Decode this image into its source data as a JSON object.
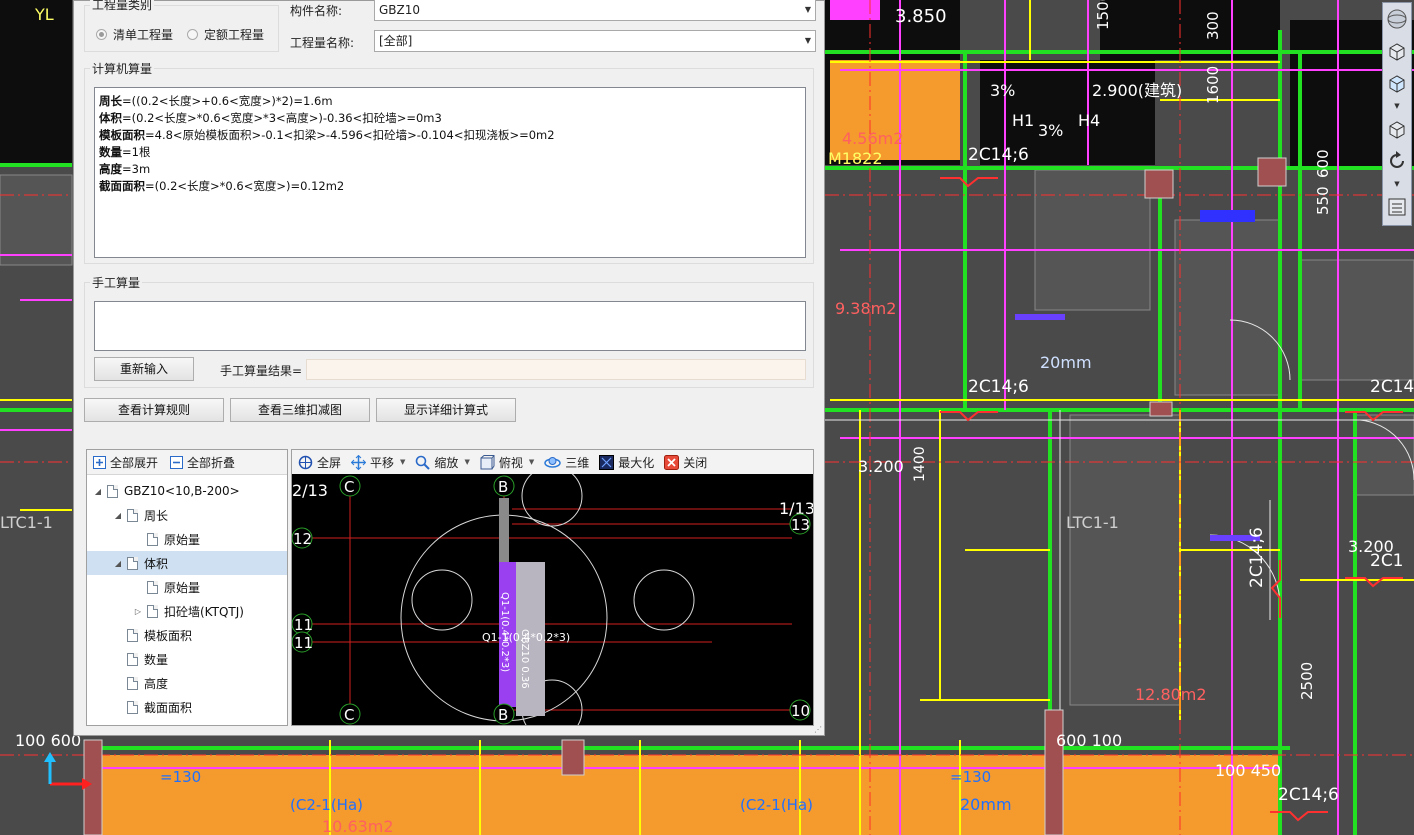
{
  "dialog": {
    "quantity_type": {
      "group_title": "工程量类别",
      "options": [
        {
          "label": "清单工程量",
          "selected": true
        },
        {
          "label": "定额工程量",
          "selected": false
        }
      ]
    },
    "component_name_label": "构件名称:",
    "component_name_value": "GBZ10",
    "quantity_name_label": "工程量名称:",
    "quantity_name_value": "[全部]",
    "computer_calc": {
      "title": "计算机算量",
      "lines": [
        {
          "key": "周长",
          "expr": "=((0.2<长度>+0.6<宽度>)*2)=1.6m"
        },
        {
          "key": "体积",
          "expr": "=(0.2<长度>*0.6<宽度>*3<高度>)-0.36<扣砼墙>=0m3"
        },
        {
          "key": "模板面积",
          "expr": "=4.8<原始模板面积>-0.1<扣梁>-4.596<扣砼墙>-0.104<扣现浇板>=0m2"
        },
        {
          "key": "数量",
          "expr": "=1根"
        },
        {
          "key": "高度",
          "expr": "=3m"
        },
        {
          "key": "截面面积",
          "expr": "=(0.2<长度>*0.6<宽度>)=0.12m2"
        }
      ]
    },
    "manual_calc": {
      "title": "手工算量",
      "reenter_button": "重新输入",
      "result_label": "手工算量结果="
    },
    "buttons": {
      "view_rules": "查看计算规则",
      "view_3d": "查看三维扣减图",
      "show_detail": "显示详细计算式"
    },
    "tree_toolbar": {
      "expand_all": "全部展开",
      "collapse_all": "全部折叠"
    },
    "tree": [
      {
        "label": "GBZ10<10,B-200>",
        "level": 0,
        "toggle": "expanded",
        "selected": false
      },
      {
        "label": "周长",
        "level": 1,
        "toggle": "expanded",
        "selected": false
      },
      {
        "label": "原始量",
        "level": 2,
        "toggle": "none",
        "selected": false
      },
      {
        "label": "体积",
        "level": 1,
        "toggle": "expanded",
        "selected": true
      },
      {
        "label": "原始量",
        "level": 2,
        "toggle": "none",
        "selected": false
      },
      {
        "label": "扣砼墙(KTQTJ)",
        "level": 2,
        "toggle": "collapsed",
        "selected": false
      },
      {
        "label": "模板面积",
        "level": 1,
        "toggle": "none",
        "selected": false
      },
      {
        "label": "数量",
        "level": 1,
        "toggle": "none",
        "selected": false
      },
      {
        "label": "高度",
        "level": 1,
        "toggle": "none",
        "selected": false
      },
      {
        "label": "截面面积",
        "level": 1,
        "toggle": "none",
        "selected": false
      }
    ],
    "viewer_toolbar": {
      "fullscreen": "全屏",
      "pan": "平移",
      "zoom": "缩放",
      "top_view": "俯视",
      "three_d": "三维",
      "maximize": "最大化",
      "close": "关闭"
    },
    "viewer_labels": {
      "axis_left_top": "2/13",
      "axis_c_top": "C",
      "axis_b_top": "B",
      "axis_right_top_a": "1/13",
      "axis_right_top_b": "13",
      "axis_12": "12",
      "axis_11a": "11",
      "axis_11b": "11",
      "axis_c_bottom": "C",
      "axis_b_bottom": "B",
      "axis_10": "10",
      "wall_label": "Q1-1(0.4*0.2*3)",
      "wall_vertical_label": "Q1-1(0.4*0.2*3)",
      "column_label": "GBZ10 0.36"
    }
  },
  "cad_labels": {
    "elev_1": "3.850",
    "elev_2": "2.900(建筑)",
    "pct_1": "3%",
    "pct_2": "3%",
    "h1": "H1",
    "h4": "H4",
    "m1822": "M1822",
    "rebar_1": "2C14;6",
    "rebar_2": "2C14;6",
    "rebar_3": "2C14",
    "rebar_4": "2C14;6",
    "rebar_5": "2C14;6",
    "rebar_6": "2C1",
    "dim_1400": "1400",
    "dim_3200a": "3.200",
    "dim_3200b": "3.200",
    "ltc_1": "LTC1-1",
    "ltc_2": "LTC1-1",
    "area_938": "9.38m2",
    "area_1280": "12.80m2",
    "dim_100_600": "100  600",
    "dim_600_100": "600   100",
    "dim_100_450": "100  450",
    "dim_2500": "2500",
    "area_456": "4.56m2",
    "dim_1600": "1600",
    "dim_300": "300",
    "dim_1500": "1500",
    "dim_550": "550",
    "dim_600": "600",
    "area_1063": "10.63m2",
    "area_20mm_a": "20mm",
    "area_20mm_b": "20mm",
    "k130_a": "=130",
    "k130_b": "=130",
    "c2_a": "(C2-1(Ha)",
    "c2_b": "(C2-1(Ha)",
    "yl": "YL"
  },
  "colors": {
    "dialog_bg": "#f0f0f0",
    "selection": "#cfe0f2",
    "cad_bg": "#4a4a4a",
    "accent_orange": "#f59a2c",
    "accent_green": "#22e022",
    "accent_magenta": "#ff40ff",
    "accent_yellow": "#ffff00"
  }
}
